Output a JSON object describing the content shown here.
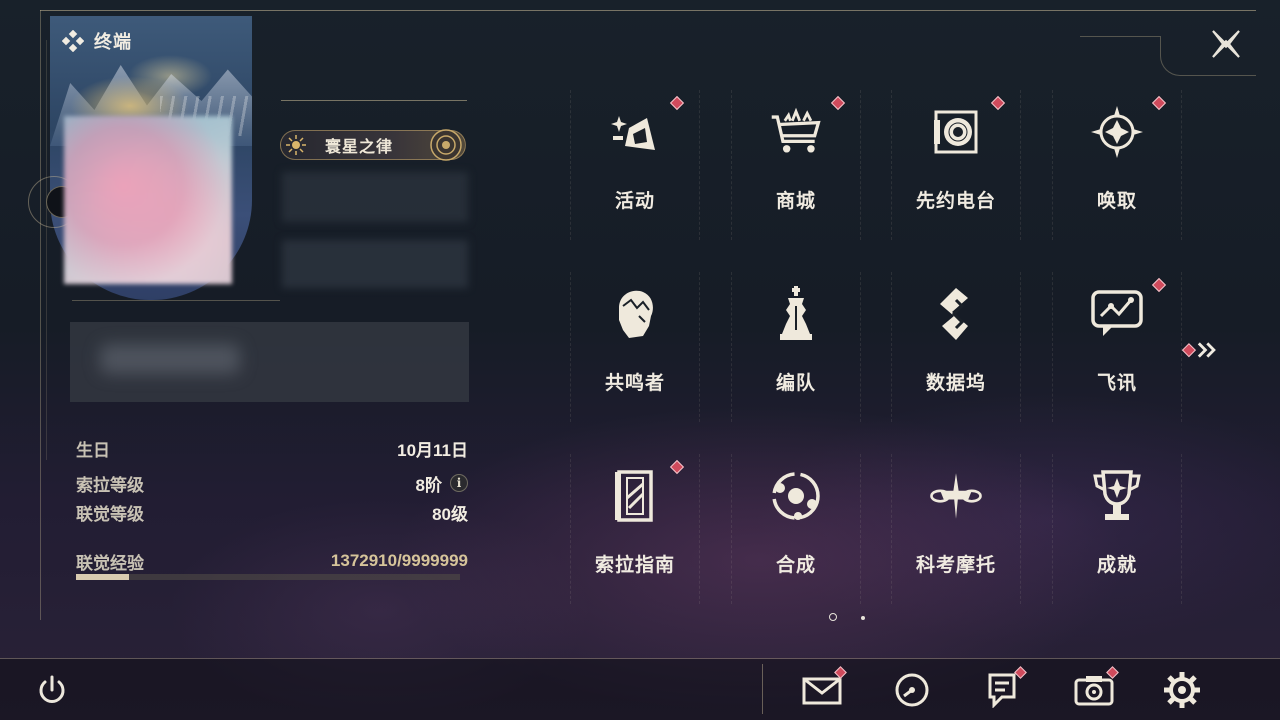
{
  "header": {
    "title": "终端"
  },
  "profile": {
    "title_badge": "寰星之律",
    "stats": [
      {
        "label": "生日",
        "value": "10月11日"
      },
      {
        "label": "索拉等级",
        "value": "8阶"
      },
      {
        "label": "联觉等级",
        "value": "80级"
      }
    ],
    "exp": {
      "label": "联觉经验",
      "value": "1372910/9999999",
      "fraction": 0.137
    }
  },
  "menu": [
    {
      "label": "活动",
      "icon": "sparkle-activity-icon",
      "badge": true
    },
    {
      "label": "商城",
      "icon": "shopping-cart-icon",
      "badge": true
    },
    {
      "label": "先约电台",
      "icon": "radio-record-icon",
      "badge": true
    },
    {
      "label": "唤取",
      "icon": "star-compass-icon",
      "badge": true
    },
    {
      "label": "共鸣者",
      "icon": "resonator-portrait-icon",
      "badge": false
    },
    {
      "label": "编队",
      "icon": "chess-piece-icon",
      "badge": false
    },
    {
      "label": "数据坞",
      "icon": "data-dock-icon",
      "badge": false
    },
    {
      "label": "飞讯",
      "icon": "chat-bubble-icon",
      "badge": true
    },
    {
      "label": "索拉指南",
      "icon": "guide-book-icon",
      "badge": true
    },
    {
      "label": "合成",
      "icon": "synthesis-orbit-icon",
      "badge": false
    },
    {
      "label": "科考摩托",
      "icon": "motorbike-icon",
      "badge": false
    },
    {
      "label": "成就",
      "icon": "trophy-icon",
      "badge": false
    }
  ],
  "pager": {
    "current": 1,
    "total": 2
  },
  "bottom_bar": [
    {
      "name": "mail",
      "icon": "mail-icon",
      "badge": true
    },
    {
      "name": "clock",
      "icon": "clock-icon",
      "badge": false
    },
    {
      "name": "notice",
      "icon": "notice-icon",
      "badge": true
    },
    {
      "name": "camera",
      "icon": "camera-icon",
      "badge": true
    },
    {
      "name": "settings",
      "icon": "gear-icon",
      "badge": false
    }
  ],
  "colors": {
    "accent_gold": "#c8b896",
    "badge_red": "#d04a5c",
    "text": "#f0ebe1"
  }
}
